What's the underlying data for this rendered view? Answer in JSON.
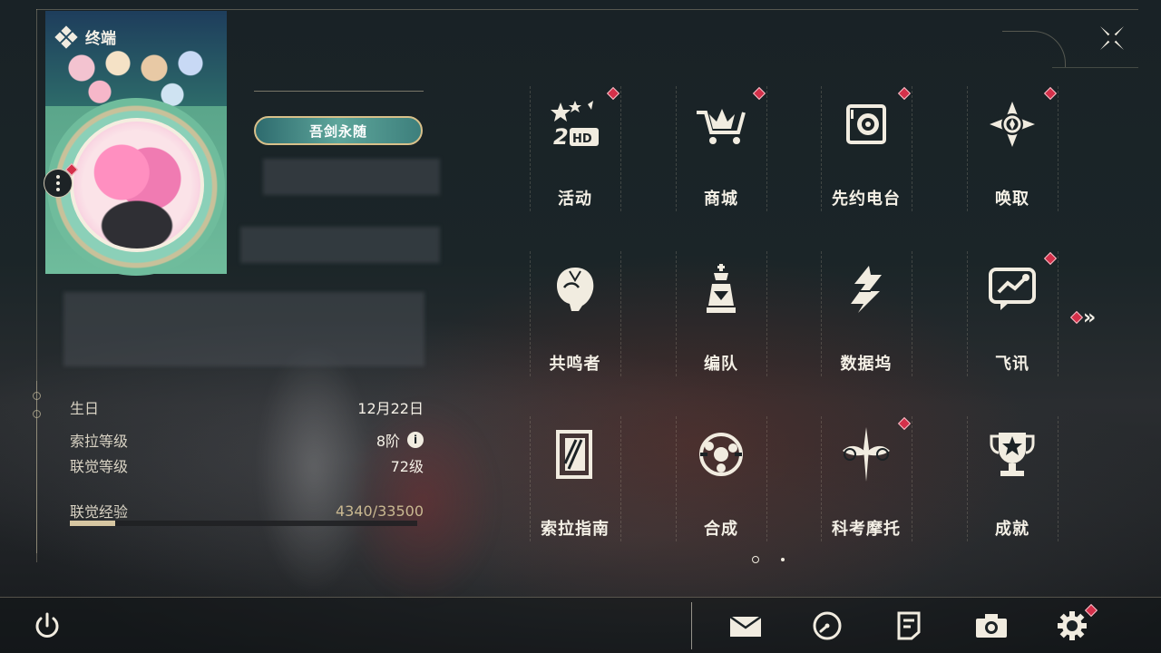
{
  "header": {
    "title": "终端",
    "terminal_icon": "diamond-cluster-icon"
  },
  "profile": {
    "title_badge": "吾剑永随",
    "birthday_label": "生日",
    "birthday_value": "12月22日",
    "sola_level_label": "索拉等级",
    "sola_level_value": "8阶",
    "union_level_label": "联觉等级",
    "union_level_value": "72级",
    "union_exp_label": "联觉经验",
    "union_exp_value": "4340/33500",
    "union_exp_progress": 0.13,
    "info_glyph": "i"
  },
  "features": [
    {
      "label": "活动",
      "icon": "event-2hd-icon",
      "alert": true
    },
    {
      "label": "商城",
      "icon": "shop-cart-icon",
      "alert": true
    },
    {
      "label": "先约电台",
      "icon": "radio-icon",
      "alert": true
    },
    {
      "label": "唤取",
      "icon": "convene-compass-icon",
      "alert": true
    },
    {
      "label": "共鸣者",
      "icon": "resonator-portrait-icon",
      "alert": false
    },
    {
      "label": "编队",
      "icon": "team-chess-icon",
      "alert": false
    },
    {
      "label": "数据坞",
      "icon": "data-dock-icon",
      "alert": false
    },
    {
      "label": "飞讯",
      "icon": "message-chat-icon",
      "alert": true
    },
    {
      "label": "索拉指南",
      "icon": "guidebook-icon",
      "alert": false
    },
    {
      "label": "合成",
      "icon": "synthesis-icon",
      "alert": false
    },
    {
      "label": "科考摩托",
      "icon": "motorbike-icon",
      "alert": true
    },
    {
      "label": "成就",
      "icon": "trophy-icon",
      "alert": false
    }
  ],
  "pagination": {
    "current": 1,
    "total": 2
  },
  "next_page": {
    "glyph": "»",
    "alert": true
  },
  "bottom_bar": {
    "items": [
      "power-icon",
      "mail-icon",
      "clock-icon",
      "notice-icon",
      "camera-icon",
      "settings-gear-icon"
    ],
    "settings_alert": true
  },
  "colors": {
    "alert": "#d4304a",
    "text": "#f4f0e6",
    "accent_gold": "#d8c08a",
    "exp_fill": "#d7c7a2"
  }
}
